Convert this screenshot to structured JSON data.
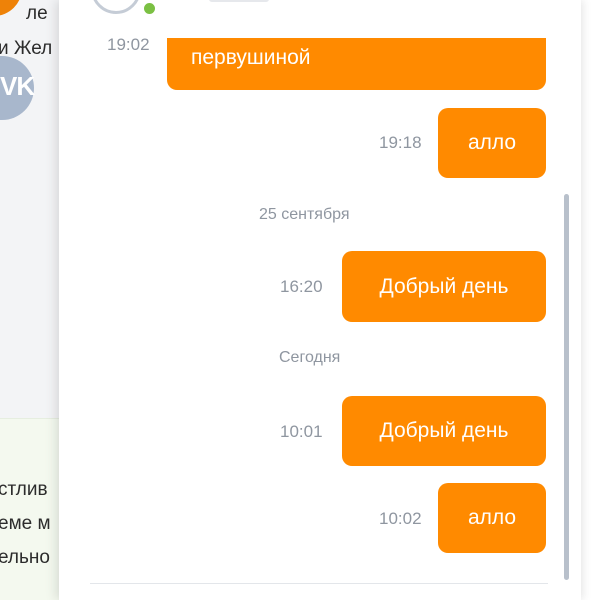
{
  "background": {
    "lines": [
      "ле",
      "Жел",
      "стлив",
      "еме м",
      "ельно"
    ],
    "vk_logo_text": "VK",
    "icons": {
      "vk": "vk-logo-icon"
    }
  },
  "header": {
    "icons": {
      "avatar": "user-avatar",
      "online": "online-status-dot"
    }
  },
  "messages": [
    {
      "time": "19:02",
      "text": "первушиной"
    },
    {
      "time": "19:18",
      "text": "алло"
    },
    {
      "date": "25 сентября"
    },
    {
      "time": "16:20",
      "text": "Добрый день"
    },
    {
      "date": "Сегодня"
    },
    {
      "time": "10:01",
      "text": "Добрый день"
    },
    {
      "time": "10:02",
      "text": "алло"
    }
  ],
  "colors": {
    "bubble": "#ff8a00",
    "time_text": "#8f96a0",
    "online": "#7bc043",
    "scrollbar": "#b8c0cb"
  }
}
